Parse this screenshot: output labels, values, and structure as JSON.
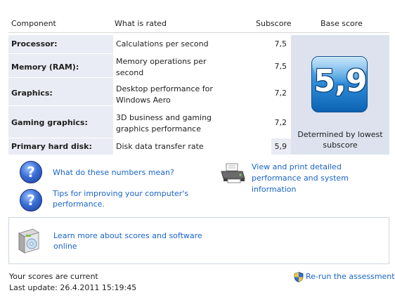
{
  "table": {
    "headers": {
      "component": "Component",
      "what_is_rated": "What is rated",
      "subscore": "Subscore",
      "base_score": "Base score"
    },
    "rows": [
      {
        "component": "Processor:",
        "rated": "Calculations per second",
        "subscore": "7,5"
      },
      {
        "component": "Memory (RAM):",
        "rated": "Memory operations per second",
        "subscore": "7,5"
      },
      {
        "component": "Graphics:",
        "rated": "Desktop performance for Windows Aero",
        "subscore": "7,2"
      },
      {
        "component": "Gaming graphics:",
        "rated": "3D business and gaming graphics performance",
        "subscore": "7,2"
      },
      {
        "component": "Primary hard disk:",
        "rated": "Disk data transfer rate",
        "subscore": "5,9"
      }
    ],
    "base_score": {
      "value": "5,9",
      "caption": "Determined by lowest subscore"
    }
  },
  "links": {
    "what_numbers_mean": "What do these numbers mean?",
    "tips": "Tips for improving your computer's performance.",
    "view_print": "View and print detailed performance and system information",
    "learn_more": "Learn more about scores and software online",
    "rerun": "Re-run the assessment"
  },
  "status": {
    "current": "Your scores are current",
    "last_update": "Last update: 26.4.2011 15:19:45"
  },
  "icons": {
    "help": "question-mark-icon",
    "print": "printer-icon",
    "learn": "software-box-icon",
    "rerun": "uac-shield-icon"
  },
  "colors": {
    "link": "#1a64c8",
    "shade": "#e9ecf4",
    "base_panel": "#dde2ee",
    "badge": "#2f8fda"
  }
}
